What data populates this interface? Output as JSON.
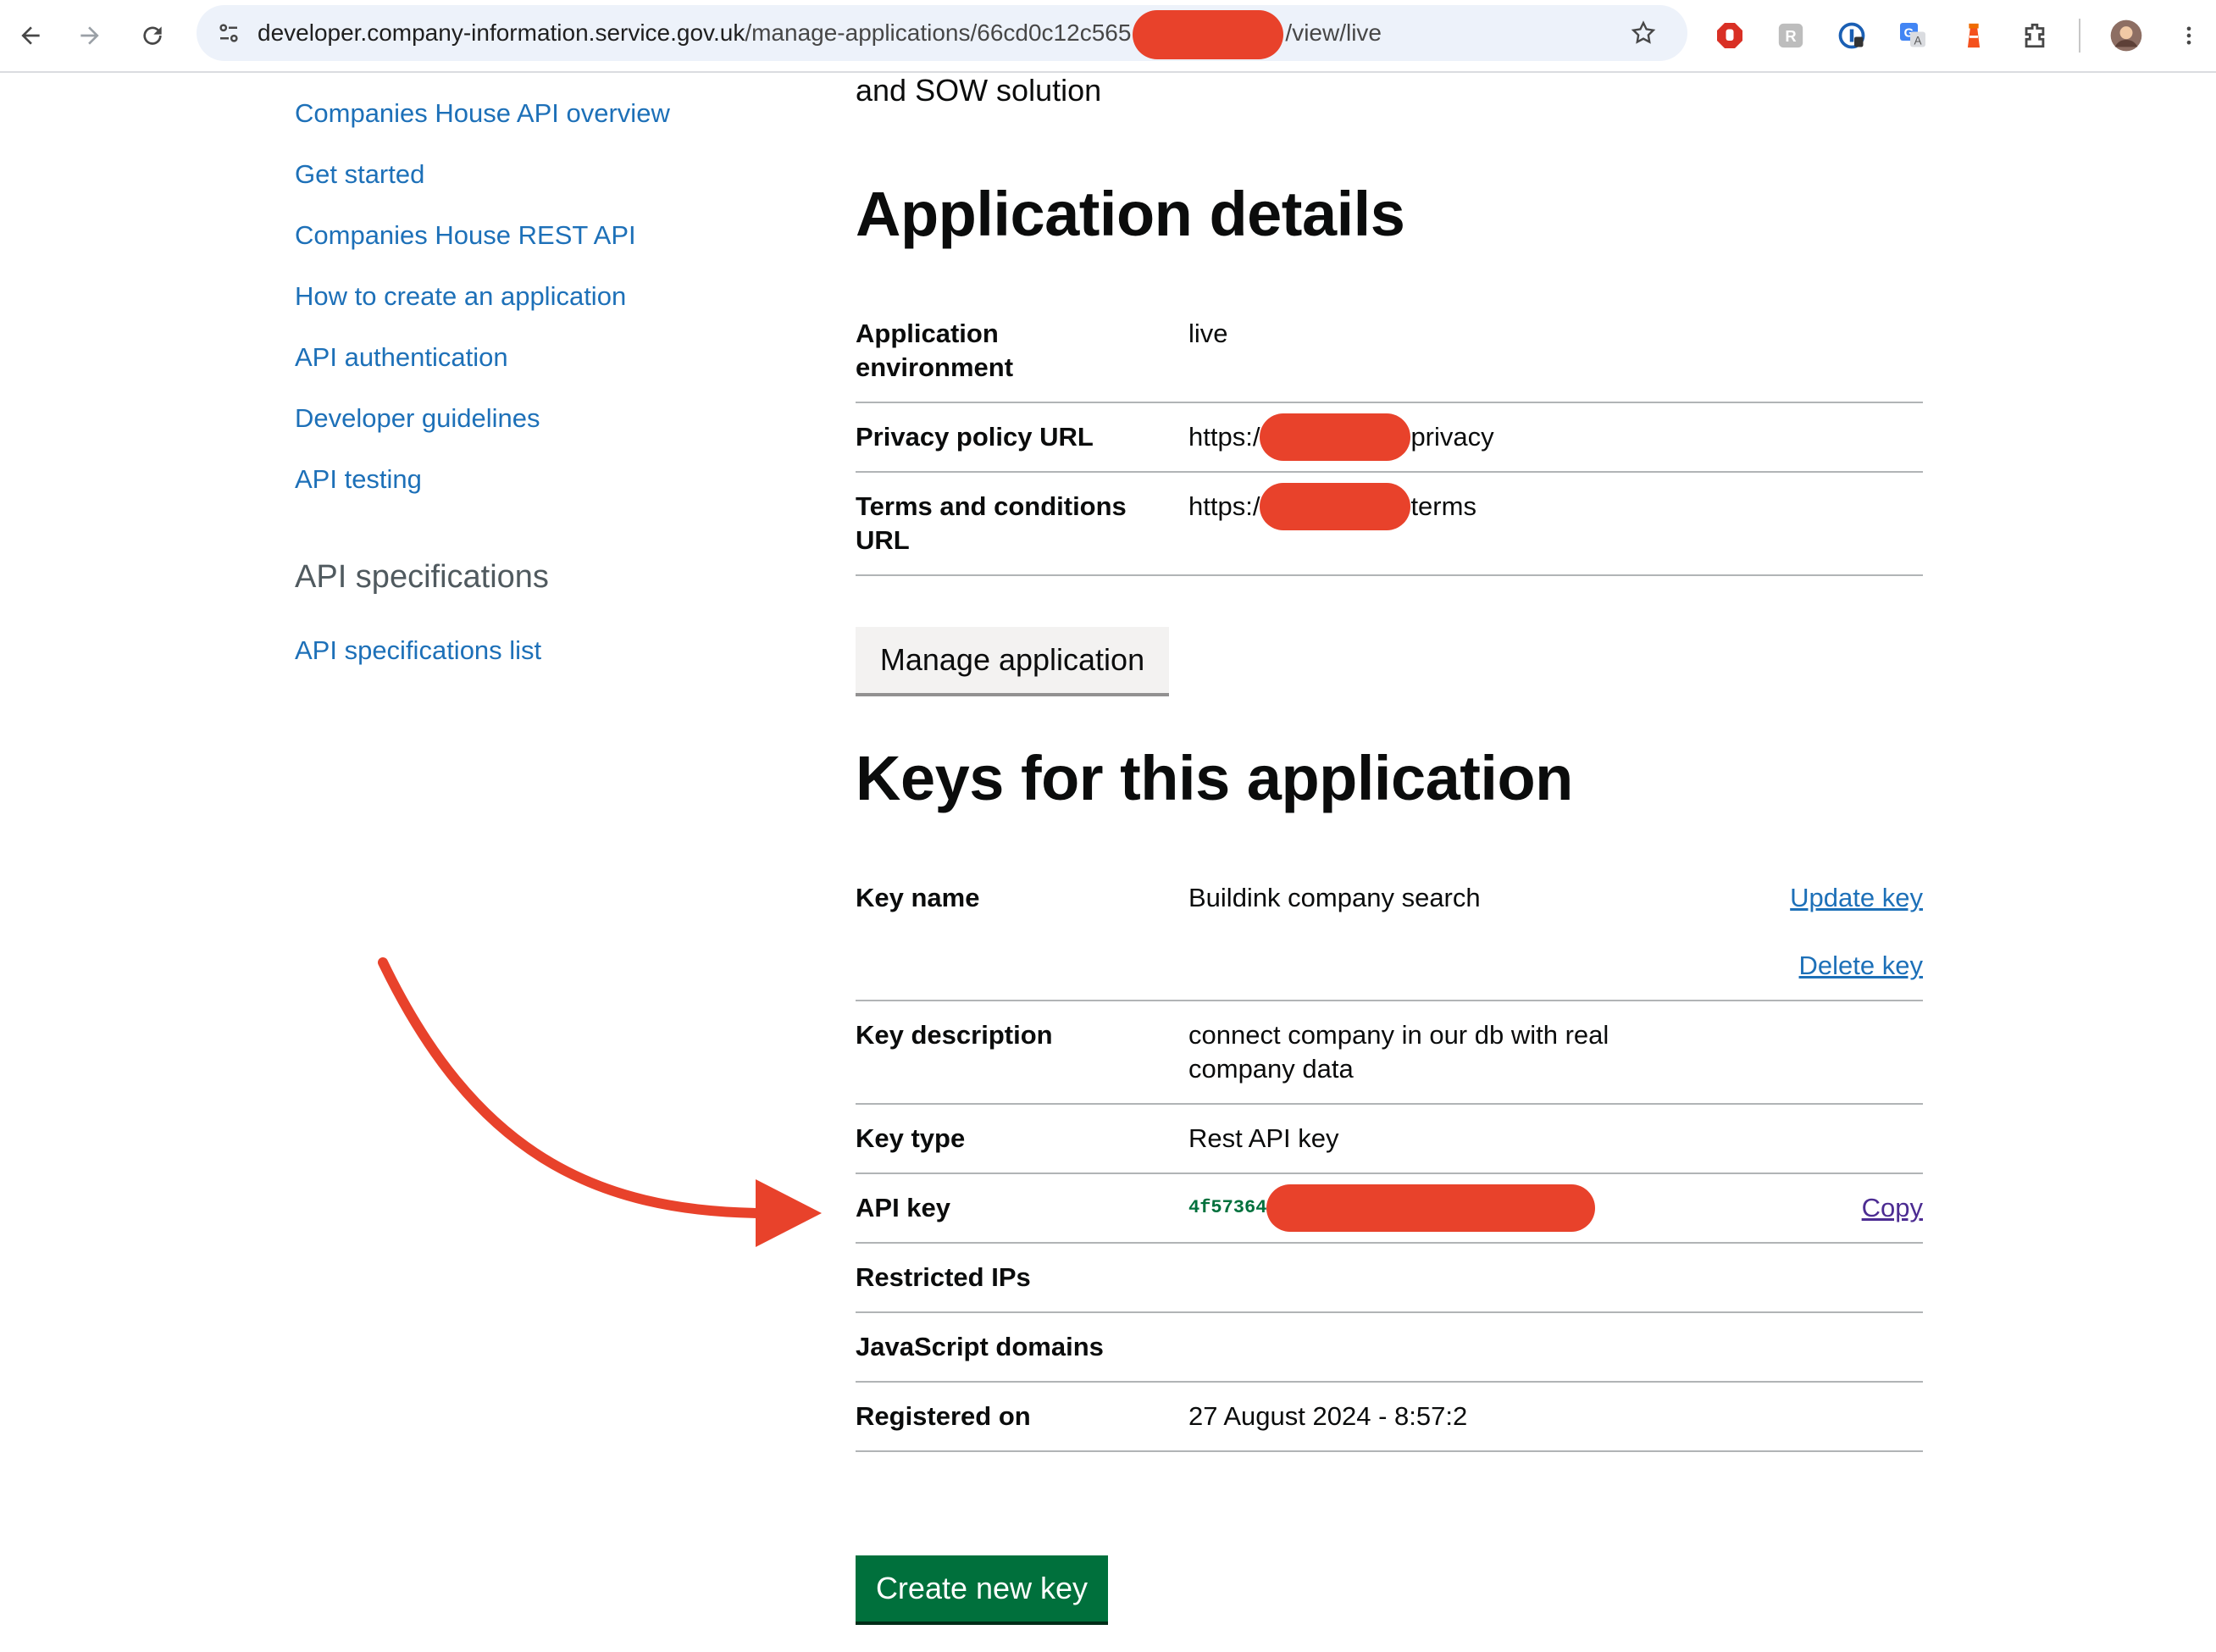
{
  "browser": {
    "url_host": "developer.company-information.service.gov.uk",
    "url_path_start": "/manage-applications/66cd0c12c565",
    "url_path_end": "/view/live"
  },
  "sidebar": {
    "links": [
      "Companies House API overview",
      "Get started",
      "Companies House REST API",
      "How to create an application",
      "API authentication",
      "Developer guidelines",
      "API testing"
    ],
    "specs_heading": "API specifications",
    "specs_link": "API specifications list"
  },
  "main": {
    "intro_fragment": "and SOW solution",
    "app_details": {
      "heading": "Application details",
      "rows": [
        {
          "key": "Application environment",
          "value": "live"
        },
        {
          "key": "Privacy policy URL",
          "value_prefix": "https:/",
          "value_suffix": "privacy"
        },
        {
          "key": "Terms and conditions URL",
          "value_prefix": "https:/",
          "value_suffix": "terms"
        }
      ],
      "manage_button": "Manage application"
    },
    "keys": {
      "heading": "Keys for this application",
      "key_name_label": "Key name",
      "key_name_value": "Buildink company search",
      "update_key": "Update key",
      "delete_key": "Delete key",
      "key_description_label": "Key description",
      "key_description_value": "connect company in our db with real company data",
      "key_type_label": "Key type",
      "key_type_value": "Rest API key",
      "api_key_label": "API key",
      "api_key_prefix": "4f57364",
      "copy": "Copy",
      "restricted_ips_label": "Restricted IPs",
      "js_domains_label": "JavaScript domains",
      "registered_on_label": "Registered on",
      "registered_on_value": "27 August 2024 - 8:57:2"
    },
    "create_button": "Create new key"
  },
  "colors": {
    "link": "#1d70b8",
    "button_green": "#00703c",
    "annotation_red": "#e8422b",
    "border": "#b1b4b6"
  }
}
